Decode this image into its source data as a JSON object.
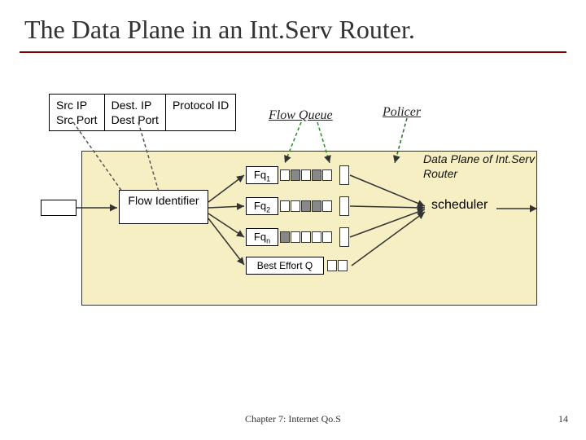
{
  "title": "The Data Plane in an Int.Serv Router.",
  "header": {
    "col1_line1": "Src IP",
    "col1_line2": "Src Port",
    "col2_line1": "Dest. IP",
    "col2_line2": "Dest Port",
    "col3": "Protocol ID"
  },
  "labels": {
    "flow_queue": "Flow Queue",
    "policer": "Policer",
    "data_plane": "Data Plane of Int.Serv Router",
    "flow_identifier": "Flow Identifier",
    "scheduler": "scheduler",
    "best_effort": "Best Effort Q"
  },
  "queues": {
    "fq1": "Fq",
    "fq1_sub": "1",
    "fq2": "Fq",
    "fq2_sub": "2",
    "fqn": "Fq",
    "fqn_sub": "n"
  },
  "footer": {
    "chapter": "Chapter 7: Internet Qo.S",
    "page": "14"
  }
}
